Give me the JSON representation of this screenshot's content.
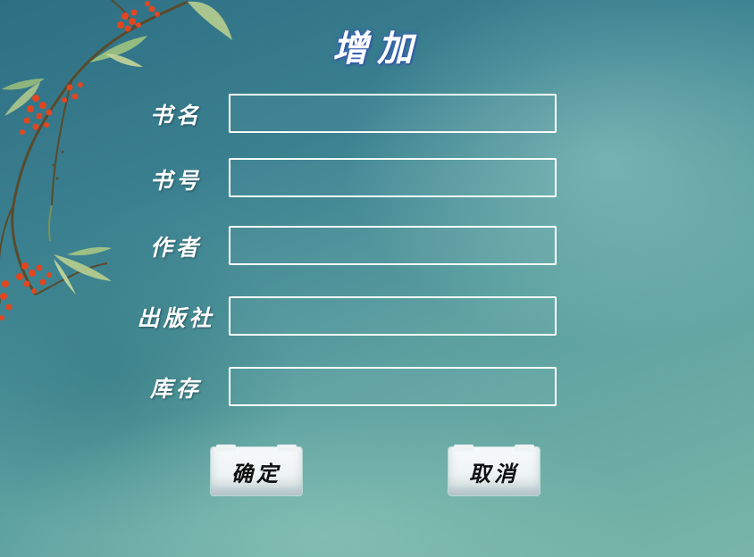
{
  "title": "增加",
  "fields": [
    {
      "label": "书名",
      "value": ""
    },
    {
      "label": "书号",
      "value": ""
    },
    {
      "label": "作者",
      "value": ""
    },
    {
      "label": "出版社",
      "value": ""
    },
    {
      "label": "库存",
      "value": ""
    }
  ],
  "buttons": {
    "confirm": "确定",
    "cancel": "取消"
  },
  "colors": {
    "background": "#4f949a",
    "text": "#ffffff",
    "field_border": "#ffffff",
    "button_bg": "#eef3f3",
    "button_text": "#111111",
    "berries": "#e2461f",
    "leaves": "#a9c98a"
  },
  "decorations": {
    "branch": "bamboo-branch-with-red-berries"
  }
}
